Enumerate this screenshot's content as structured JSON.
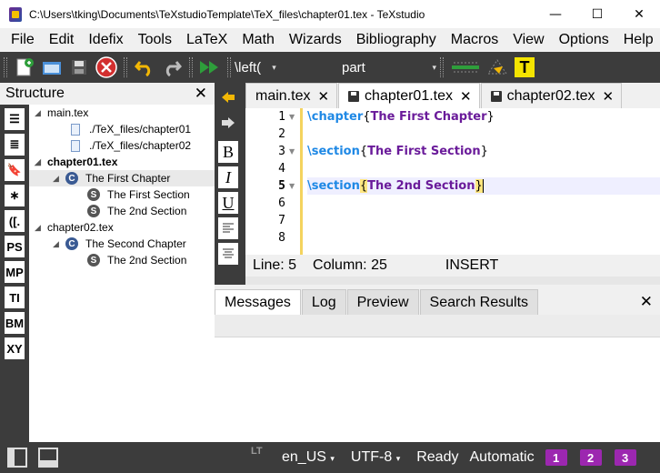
{
  "window": {
    "title": "C:\\Users\\tking\\Documents\\TeXstudioTemplate\\TeX_files\\chapter01.tex - TeXstudio",
    "minimize": "—",
    "maximize": "☐",
    "close": "✕"
  },
  "menu": [
    "File",
    "Edit",
    "Idefix",
    "Tools",
    "LaTeX",
    "Math",
    "Wizards",
    "Bibliography",
    "Macros",
    "View",
    "Options",
    "Help"
  ],
  "toolbar": {
    "left_combo": "\\left(",
    "struct_combo": "part"
  },
  "structure": {
    "title": "Structure",
    "close": "✕",
    "side_icons": [
      "ToC",
      "List",
      "Bookmark",
      "∗",
      "([.",
      "PS",
      "MP",
      "TI",
      "BM",
      "XY"
    ],
    "tree": [
      {
        "label": "main.tex",
        "level": 0,
        "expanded": true
      },
      {
        "label": "./TeX_files/chapter01",
        "level": 1,
        "icon": "file-icon"
      },
      {
        "label": "./TeX_files/chapter02",
        "level": 1,
        "icon": "file-icon"
      },
      {
        "label": "chapter01.tex",
        "level": 0,
        "expanded": true,
        "bold": true
      },
      {
        "label": "The First Chapter",
        "level": 1,
        "icon": "chapter-icon",
        "selected": true
      },
      {
        "label": "The First Section",
        "level": 2,
        "icon": "section-icon"
      },
      {
        "label": "The 2nd Section",
        "level": 2,
        "icon": "section-icon"
      },
      {
        "label": "chapter02.tex",
        "level": 0,
        "expanded": true
      },
      {
        "label": "The Second Chapter",
        "level": 1,
        "icon": "chapter-icon"
      },
      {
        "label": "The 2nd Section",
        "level": 2,
        "icon": "section-icon"
      }
    ]
  },
  "editor_tools": [
    "B",
    "I",
    "U"
  ],
  "tabs": [
    {
      "label": "main.tex",
      "active": false,
      "modified": false
    },
    {
      "label": "chapter01.tex",
      "active": true,
      "modified": true
    },
    {
      "label": "chapter02.tex",
      "active": false,
      "modified": true
    }
  ],
  "editor": {
    "line_numbers": [
      "1",
      "2",
      "3",
      "4",
      "5",
      "6",
      "7",
      "8"
    ],
    "current_line": 5,
    "lines": [
      {
        "cmd": "\\chapter",
        "open": "{",
        "arg": "The First Chapter",
        "close": "}"
      },
      {
        "cmd": "",
        "open": "",
        "arg": "",
        "close": ""
      },
      {
        "cmd": "\\section",
        "open": "{",
        "arg": "The First Section",
        "close": "}"
      },
      {
        "cmd": "",
        "open": "",
        "arg": "",
        "close": ""
      },
      {
        "cmd": "\\section",
        "open": "{",
        "arg": "The 2nd Section",
        "close": "}"
      }
    ]
  },
  "status_line": {
    "line": "Line: 5",
    "column": "Column: 25",
    "mode": "INSERT"
  },
  "bottom_tabs": [
    "Messages",
    "Log",
    "Preview",
    "Search Results"
  ],
  "bottom_close": "✕",
  "statusbar": {
    "language": "en_US",
    "encoding": "UTF-8",
    "status": "Ready",
    "compile": "Automatic",
    "bookmarks": [
      "1",
      "2",
      "3"
    ]
  },
  "colors": {
    "latex_command": "#1e88e5",
    "latex_argument": "#6a1b9a",
    "toolbar_bg": "#3c3c3c",
    "current_line_bg": "#efefff"
  }
}
